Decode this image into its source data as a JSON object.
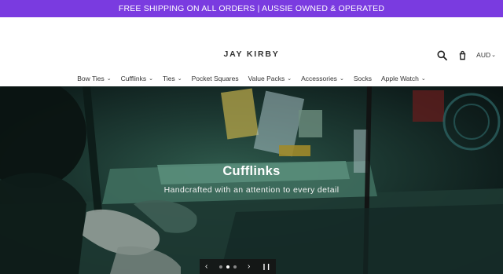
{
  "announcement": "FREE SHIPPING ON ALL ORDERS | AUSSIE OWNED & OPERATED",
  "brand": "JAY KIRBY",
  "currency": "AUD",
  "icons": {
    "search": "search-icon",
    "cart": "cart-icon"
  },
  "nav": [
    {
      "label": "Bow Ties",
      "dropdown": true
    },
    {
      "label": "Cufflinks",
      "dropdown": true
    },
    {
      "label": "Ties",
      "dropdown": true
    },
    {
      "label": "Pocket Squares",
      "dropdown": false
    },
    {
      "label": "Value Packs",
      "dropdown": true
    },
    {
      "label": "Accessories",
      "dropdown": true
    },
    {
      "label": "Socks",
      "dropdown": false
    },
    {
      "label": "Apple Watch",
      "dropdown": true
    }
  ],
  "hero": {
    "title": "Cufflinks",
    "subtitle": "Handcrafted with an attention to every detail",
    "slides_total": 3,
    "active_slide": 2
  },
  "colors": {
    "announcement_bg": "#7a3be0",
    "text": "#333333"
  }
}
